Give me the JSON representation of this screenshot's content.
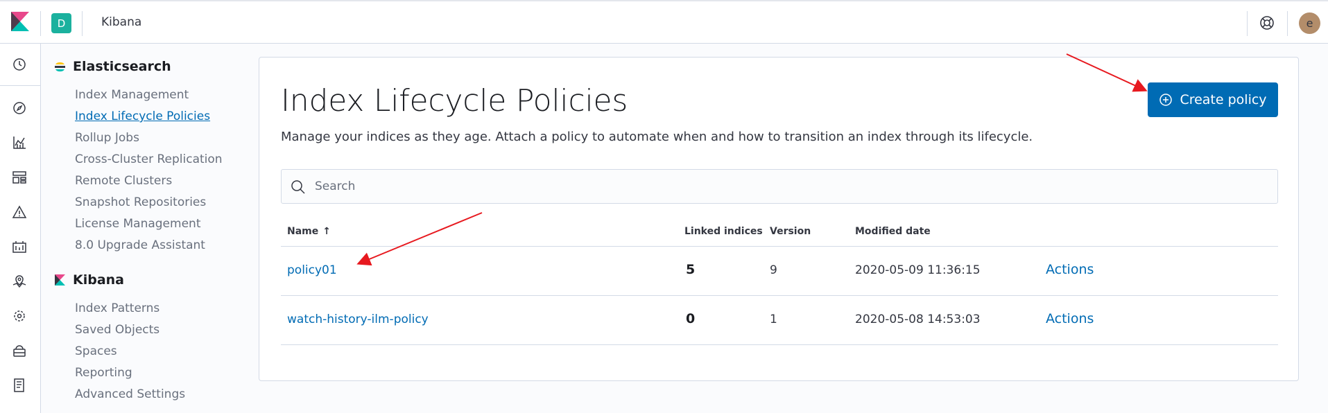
{
  "header": {
    "space_initial": "D",
    "app_title": "Kibana",
    "user_initial": "e"
  },
  "icon_nav": [
    "clock-icon",
    "compass-icon",
    "visualize-icon",
    "dashboard-icon",
    "alert-icon",
    "canvas-icon",
    "maps-icon",
    "ml-icon",
    "infra-icon",
    "logs-icon"
  ],
  "sidenav": {
    "elasticsearch_title": "Elasticsearch",
    "elasticsearch_items": [
      "Index Management",
      "Index Lifecycle Policies",
      "Rollup Jobs",
      "Cross-Cluster Replication",
      "Remote Clusters",
      "Snapshot Repositories",
      "License Management",
      "8.0 Upgrade Assistant"
    ],
    "kibana_title": "Kibana",
    "kibana_items": [
      "Index Patterns",
      "Saved Objects",
      "Spaces",
      "Reporting",
      "Advanced Settings"
    ]
  },
  "main": {
    "title": "Index Lifecycle Policies",
    "description": "Manage your indices as they age. Attach a policy to automate when and how to transition an index through its lifecycle.",
    "create_button": "Create policy",
    "search_placeholder": "Search",
    "columns": [
      "Name",
      "Linked indices",
      "Version",
      "Modified date"
    ],
    "sort_indicator": "↑",
    "rows": [
      {
        "name": "policy01",
        "linked": "5",
        "version": "9",
        "modified": "2020-05-09 11:36:15",
        "action": "Actions"
      },
      {
        "name": "watch-history-ilm-policy",
        "linked": "0",
        "version": "1",
        "modified": "2020-05-08 14:53:03",
        "action": "Actions"
      }
    ]
  },
  "colors": {
    "primary": "#006bb4",
    "annotation": "#e7191f",
    "space_badge": "#1bb19e"
  }
}
